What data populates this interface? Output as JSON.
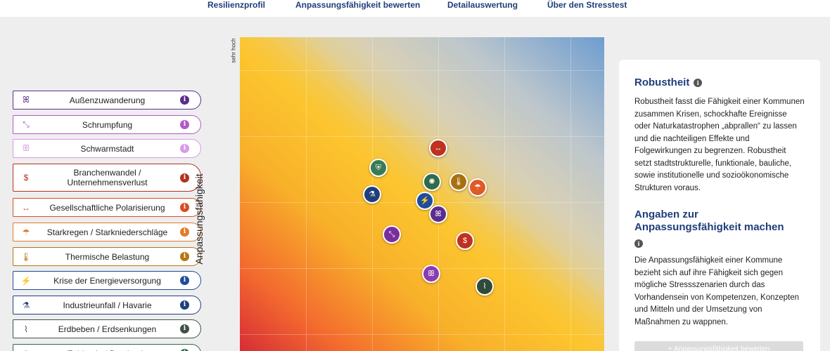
{
  "nav": {
    "items": [
      "Resilienzprofil",
      "Anpassungsfähigkeit bewerten",
      "Detailauswertung",
      "Über den Stresstest"
    ]
  },
  "hazards": [
    {
      "label": "Außenzuwanderung",
      "color": "#5b2d8e",
      "icon": "people-icon",
      "glyph": "ꕤ"
    },
    {
      "label": "Schrumpfung",
      "color": "#b05ac8",
      "icon": "shrink-arrows-icon",
      "glyph": "⤡"
    },
    {
      "label": "Schwarmstadt",
      "color": "#d79be6",
      "icon": "swarm-people-icon",
      "glyph": "ꕥ"
    },
    {
      "label": "Branchenwandel / Unternehmensverlust",
      "color": "#b2331f",
      "icon": "money-cycle-icon",
      "glyph": "$"
    },
    {
      "label": "Gesellschaftliche Polarisierung",
      "color": "#d84d24",
      "icon": "double-arrow-icon",
      "glyph": "↔"
    },
    {
      "label": "Starkregen / Starkniederschläge",
      "color": "#e27b2a",
      "icon": "rain-cloud-icon",
      "glyph": "☂"
    },
    {
      "label": "Thermische Belastung",
      "color": "#b57712",
      "icon": "thermometer-icon",
      "glyph": "🌡"
    },
    {
      "label": "Krise der Energieversorgung",
      "color": "#1e4e9a",
      "icon": "no-power-icon",
      "glyph": "⚡"
    },
    {
      "label": "Industrieunfall / Havarie",
      "color": "#1e3f7a",
      "icon": "test-tube-icon",
      "glyph": "⚗"
    },
    {
      "label": "Erdbeben / Erdsenkungen",
      "color": "#3f5247",
      "icon": "earthquake-icon",
      "glyph": "⌇"
    },
    {
      "label": "Epidemie / Pandemie",
      "color": "#2f6b4a",
      "icon": "virus-icon",
      "glyph": "✺"
    }
  ],
  "info_glyph": "i",
  "chart": {
    "ylabel": "Anpassungsfähigkeit",
    "ytick_top": "sehr hoch"
  },
  "markers": [
    {
      "icon": "double-arrow-icon",
      "glyph": "↔",
      "color": "#c0311f"
    },
    {
      "icon": "shield-icon",
      "glyph": "⛨",
      "color": "#3a7a55"
    },
    {
      "icon": "virus-icon",
      "glyph": "✺",
      "color": "#2f6b4a"
    },
    {
      "icon": "thermometer-icon",
      "glyph": "🌡",
      "color": "#a8700f"
    },
    {
      "icon": "rain-cloud-icon",
      "glyph": "☂",
      "color": "#e05a26"
    },
    {
      "icon": "test-tube-icon",
      "glyph": "⚗",
      "color": "#1e3f7a"
    },
    {
      "icon": "no-power-icon",
      "glyph": "⚡",
      "color": "#1e4e9a"
    },
    {
      "icon": "people-icon",
      "glyph": "ꕤ",
      "color": "#5b2d8e"
    },
    {
      "icon": "shrink-arrows-icon",
      "glyph": "⤡",
      "color": "#7a2e9e"
    },
    {
      "icon": "money-cycle-icon",
      "glyph": "$",
      "color": "#c0311f"
    },
    {
      "icon": "swarm-people-icon",
      "glyph": "ꕥ",
      "color": "#8a3cb0"
    },
    {
      "icon": "earthquake-icon",
      "glyph": "⌇",
      "color": "#2f4a3a"
    }
  ],
  "panel": {
    "title1": "Robustheit",
    "text1": "Robustheit fasst die Fähigkeit einer Kommunen zusammen Krisen, schockhafte Ereignisse oder Naturkatastrophen „abprallen“ zu lassen und die nachteiligen Effekte und Folgewirkungen zu begrenzen. Robustheit setzt stadtstrukturelle, funktionale, bauliche, sowie institutionelle und sozioökonomische Strukturen voraus.",
    "title2": "Angaben zur Anpassungsfähigkeit machen",
    "text2": "Die Anpassungsfähigkeit einer Kommune bezieht sich auf ihre Fähigkeit sich gegen mögliche Stressszenarien durch das Vorhandensein von Kompetenzen, Konzepten und Mitteln und der Umsetzung von Maßnahmen zu wappnen.",
    "button": "+ Anpassungsfähigkeit bewerten"
  }
}
